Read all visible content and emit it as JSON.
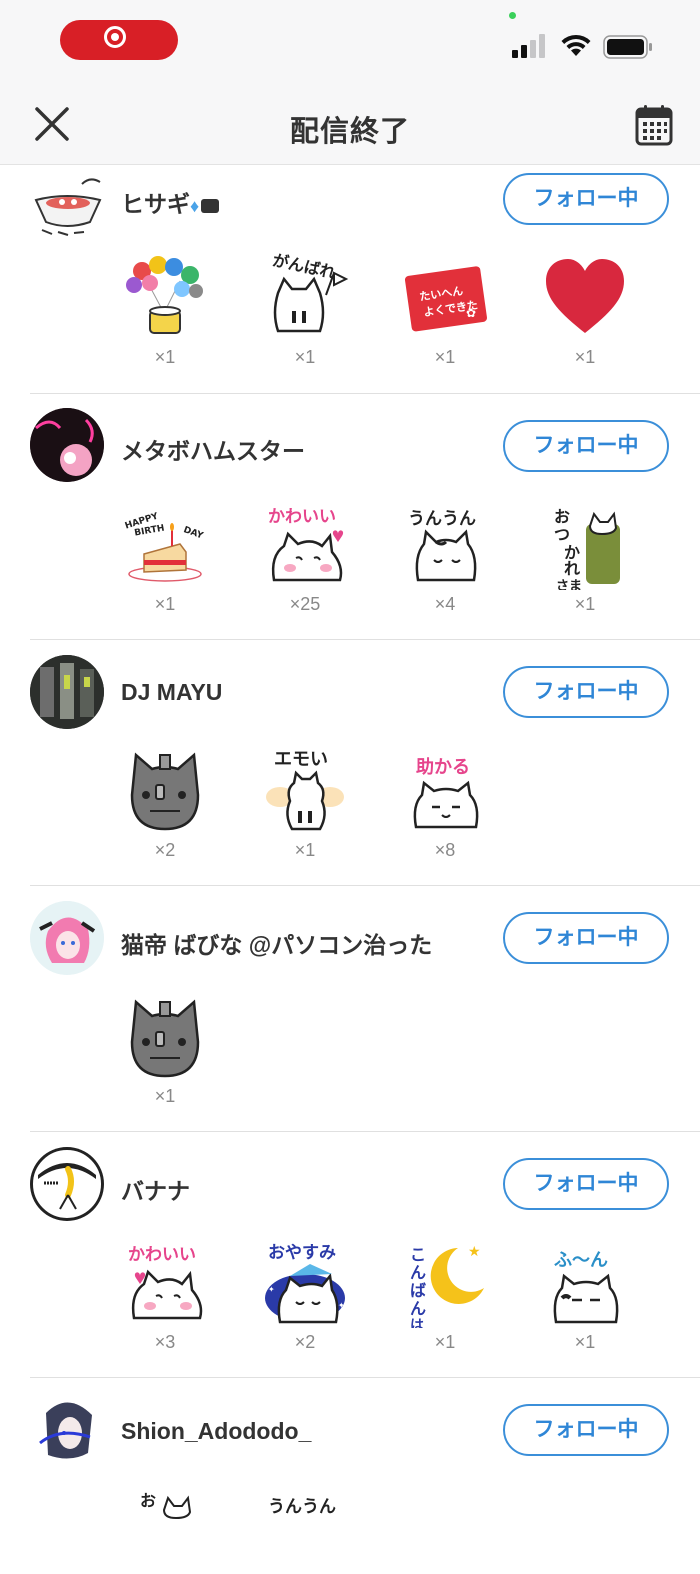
{
  "nav": {
    "title": "配信終了"
  },
  "colors": {
    "follow_accent": "#2f86d6",
    "record_red": "#d81f26"
  },
  "rows": [
    {
      "name": "ヒサギ",
      "name_badges": [
        "diamond-icon",
        "camera-icon"
      ],
      "button": "フォロー中",
      "gifts": [
        {
          "icon": "balloons-icon",
          "count": "×1"
        },
        {
          "icon": "ganbare-cat-stamp",
          "count": "×1",
          "label": "がんばれ"
        },
        {
          "icon": "red-stamp-card",
          "count": "×1",
          "label": "たいへんよくできました"
        },
        {
          "icon": "heart-icon",
          "count": "×1"
        }
      ]
    },
    {
      "name": "メタボハムスター",
      "button": "フォロー中",
      "gifts": [
        {
          "icon": "birthday-cake-icon",
          "count": "×1",
          "label": "HAPPY BIRTH DAY"
        },
        {
          "icon": "kawaii-cat-stamp",
          "count": "×25",
          "label": "かわいい"
        },
        {
          "icon": "unun-cat-stamp",
          "count": "×4",
          "label": "うんうん"
        },
        {
          "icon": "otsukaresama-cat-stamp",
          "count": "×1",
          "label": "おつかれさま"
        }
      ]
    },
    {
      "name": "DJ MAYU",
      "button": "フォロー中",
      "gifts": [
        {
          "icon": "robot-cat-icon",
          "count": "×2"
        },
        {
          "icon": "emoi-cat-stamp",
          "count": "×1",
          "label": "エモい"
        },
        {
          "icon": "tasukaru-cat-stamp",
          "count": "×8",
          "label": "助かる"
        }
      ]
    },
    {
      "name": "猫帝 ばびな @パソコン治った",
      "button": "フォロー中",
      "gifts": [
        {
          "icon": "robot-cat-icon",
          "count": "×1"
        }
      ]
    },
    {
      "name": "バナナ",
      "button": "フォロー中",
      "gifts": [
        {
          "icon": "kawaii-cat-stamp",
          "count": "×3",
          "label": "かわいい"
        },
        {
          "icon": "oyasumi-cat-stamp",
          "count": "×2",
          "label": "おやすみ"
        },
        {
          "icon": "konbanha-moon-stamp",
          "count": "×1",
          "label": "こんばんは"
        },
        {
          "icon": "fun-cat-stamp",
          "count": "×1",
          "label": "ふ〜ん"
        }
      ]
    },
    {
      "name": "Shion_Adododo_",
      "button": "フォロー中",
      "gifts": [
        {
          "icon": "otsukaresama-cat-stamp",
          "label": "おつ"
        },
        {
          "icon": "unun-cat-stamp",
          "label": "うんうん"
        }
      ]
    }
  ]
}
